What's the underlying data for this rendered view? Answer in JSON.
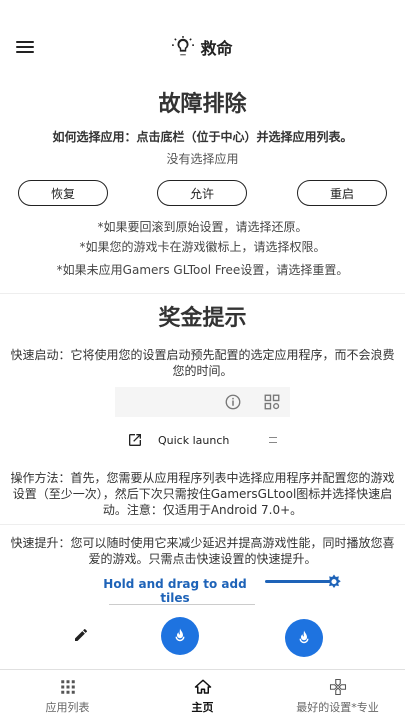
{
  "appbar": {
    "title": "救命"
  },
  "troubleshoot": {
    "title": "故障排除",
    "how_to": "如何选择应用：点击底栏（位于中心）并选择应用列表。",
    "none_selected": "没有选择应用",
    "buttons": {
      "restore": "恢复",
      "permit": "允许",
      "restart": "重启"
    },
    "notes": [
      "*如果要回滚到原始设置，请选择还原。",
      "*如果您的游戏卡在游戏徽标上，请选择权限。",
      "*如果未应用Gamers GLTool Free设置，请选择重置。"
    ]
  },
  "bonus": {
    "title": "奖金提示",
    "quick_start": "快速启动：它将使用您的设置启动预先配置的选定应用程序，而不会浪费您的时间。",
    "quick_launch_label": "Quick launch",
    "instructions": "操作方法：首先，您需要从应用程序列表中选择应用程序并配置您的游戏设置（至少一次），然后下次只需按住GamersGLtool图标并选择快速启动。注意：仅适用于Android 7.0+。",
    "boost": "快速提升：您可以随时使用它来减少延迟并提高游戏性能，同时播放您喜爱的游戏。只需点击快速设置的快速提升。",
    "tiles_label": "Hold and drag to add tiles"
  },
  "bottom_nav": {
    "items": [
      {
        "label": "应用列表"
      },
      {
        "label": "主页"
      },
      {
        "label": "最好的设置*专业"
      }
    ],
    "active_index": 1
  },
  "colors": {
    "accent": "#1e73e0",
    "link": "#1e63b8"
  }
}
